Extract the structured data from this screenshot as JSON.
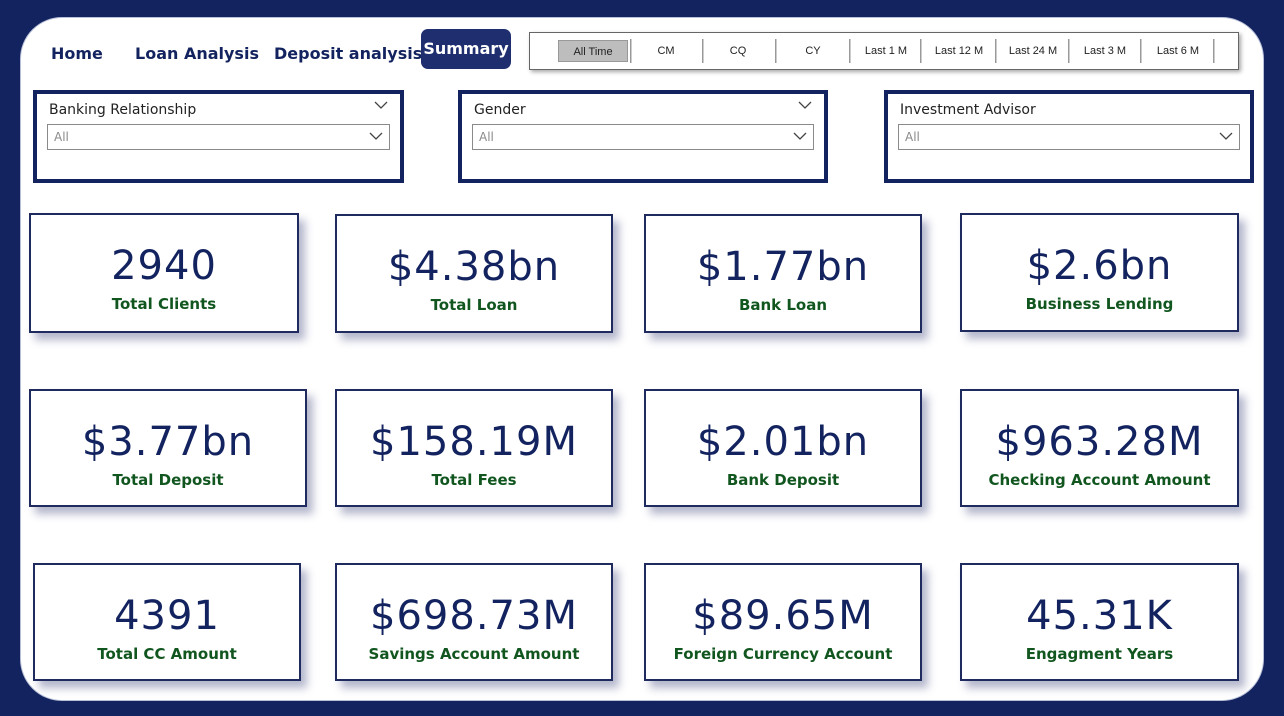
{
  "nav": {
    "home": "Home",
    "loan": "Loan Analysis",
    "deposit": "Deposit analysis",
    "summary": "Summary"
  },
  "time_slicer": {
    "options": [
      "All Time",
      "CM",
      "CQ",
      "CY",
      "Last 1 M",
      "Last 12 M",
      "Last 24 M",
      "Last 3 M",
      "Last 6 M"
    ],
    "selected": "All Time"
  },
  "filters": [
    {
      "title": "Banking Relationship",
      "value": "All"
    },
    {
      "title": "Gender",
      "value": "All"
    },
    {
      "title": "Investment Advisor",
      "value": "All"
    }
  ],
  "cards": [
    {
      "value": "2940",
      "label": "Total Clients"
    },
    {
      "value": "$4.38bn",
      "label": "Total Loan"
    },
    {
      "value": "$1.77bn",
      "label": "Bank Loan"
    },
    {
      "value": "$2.6bn",
      "label": "Business Lending"
    },
    {
      "value": "$3.77bn",
      "label": "Total Deposit"
    },
    {
      "value": "$158.19M",
      "label": "Total Fees"
    },
    {
      "value": "$2.01bn",
      "label": "Bank Deposit"
    },
    {
      "value": "$963.28M",
      "label": "Checking Account Amount"
    },
    {
      "value": "4391",
      "label": "Total CC Amount"
    },
    {
      "value": "$698.73M",
      "label": "Savings Account Amount"
    },
    {
      "value": "$89.65M",
      "label": "Foreign Currency Account"
    },
    {
      "value": "45.31K",
      "label": "Engagment Years"
    }
  ],
  "colors": {
    "background": "#13235f",
    "accent": "#1f2e6e",
    "card_value": "#13235f",
    "card_label": "#11561f"
  }
}
